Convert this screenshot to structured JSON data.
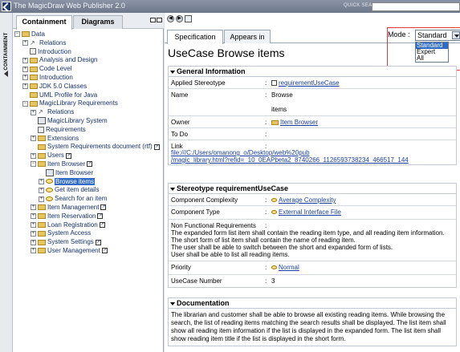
{
  "app": {
    "title": "The MagicDraw Web Publisher 2.0",
    "quick_search_label": "QUICK SEARCH",
    "quick_search_value": ""
  },
  "vertical_tab": {
    "label": "CONTAINMENT"
  },
  "left_tabs": [
    "Containment",
    "Diagrams"
  ],
  "tree": [
    {
      "label": "Data",
      "icon": "folder",
      "exp": "-",
      "depth": 0
    },
    {
      "label": "Relations",
      "icon": "relation",
      "exp": "+",
      "depth": 1
    },
    {
      "label": "Introduction",
      "icon": "doc",
      "exp": "",
      "depth": 1
    },
    {
      "label": "Analysis and Design",
      "icon": "folder",
      "exp": "+",
      "depth": 1
    },
    {
      "label": "Code Level",
      "icon": "folder",
      "exp": "+",
      "depth": 1
    },
    {
      "label": "Introduction",
      "icon": "folder",
      "exp": "+",
      "depth": 1
    },
    {
      "label": "JDK 5.0 Classes",
      "icon": "folder",
      "exp": "+",
      "depth": 1
    },
    {
      "label": "UML Profile for Java",
      "icon": "folder",
      "exp": "",
      "depth": 1
    },
    {
      "label": "MagicLibrary Requirements",
      "icon": "folder",
      "exp": "-",
      "depth": 1
    },
    {
      "label": "Relations",
      "icon": "relation",
      "exp": "+",
      "depth": 2
    },
    {
      "label": "MagicLibrary System",
      "icon": "diagram",
      "exp": "",
      "depth": 2
    },
    {
      "label": "Requirements",
      "icon": "doc",
      "exp": "",
      "depth": 2
    },
    {
      "label": "Extensions",
      "icon": "folder",
      "exp": "+",
      "depth": 2
    },
    {
      "label": "System Requirements document (rtf)",
      "icon": "folder",
      "exp": "",
      "depth": 2,
      "link": true
    },
    {
      "label": "Users",
      "icon": "folder",
      "exp": "+",
      "depth": 2,
      "link": true
    },
    {
      "label": "Item Browser",
      "icon": "folder",
      "exp": "-",
      "depth": 2,
      "link": true
    },
    {
      "label": "Item Browser",
      "icon": "diagram",
      "exp": "",
      "depth": 3
    },
    {
      "label": "Browse items",
      "icon": "usecase",
      "exp": "+",
      "depth": 3,
      "selected": true
    },
    {
      "label": "Get item details",
      "icon": "usecase",
      "exp": "+",
      "depth": 3
    },
    {
      "label": "Search for an item",
      "icon": "usecase",
      "exp": "+",
      "depth": 3
    },
    {
      "label": "Item Management",
      "icon": "folder",
      "exp": "+",
      "depth": 2,
      "link": true
    },
    {
      "label": "Item Reservation",
      "icon": "folder",
      "exp": "+",
      "depth": 2,
      "link": true
    },
    {
      "label": "Loan Registration",
      "icon": "folder",
      "exp": "+",
      "depth": 2,
      "link": true
    },
    {
      "label": "System Access",
      "icon": "folder",
      "exp": "+",
      "depth": 2
    },
    {
      "label": "System Settings",
      "icon": "folder",
      "exp": "+",
      "depth": 2,
      "link": true
    },
    {
      "label": "User Management",
      "icon": "folder",
      "exp": "+",
      "depth": 2,
      "link": true
    }
  ],
  "right_tabs": [
    "Specification",
    "Appears in"
  ],
  "mode": {
    "label": "Mode :",
    "selected": "Standard",
    "options": [
      "Standard",
      "Expert",
      "All"
    ],
    "highlighted": "Standard"
  },
  "page_title": "UseCase Browse items",
  "general": {
    "heading": "General Information",
    "applied_stereotype_label": "Applied Stereotype",
    "applied_stereotype_value": "requirementUseCase",
    "name_label": "Name",
    "name_value_1": "Browse",
    "name_value_2": "items",
    "owner_label": "Owner",
    "owner_value": "Item Browser",
    "todo_label": "To Do",
    "link_label": "Link",
    "link_value_1": "file:///C:/Users/omanong_o/Desktop/web%20pub",
    "link_value_2": "/magic_library.html?refid=_10_0EAPbeta2_8740266_1126593738234_466517_144"
  },
  "stereotype": {
    "heading": "Stereotype requirementUseCase",
    "complexity_label": "Component Complexity",
    "complexity_value": "Average Complexity",
    "type_label": "Component Type",
    "type_value": "External Interface File",
    "nfr_label": "Non Functional Requirements",
    "nfr_lines": [
      "The expanded form list item shall contain the reading item type, and all reading item information.",
      "The short form of list item shall contain the name of reading item.",
      "The user shall be able to switch between the short and expanded form of lists.",
      "User shall be able to list all reading items."
    ],
    "priority_label": "Priority",
    "priority_value": "Normal",
    "ucnum_label": "UseCase Number",
    "ucnum_value": "3"
  },
  "documentation": {
    "heading": "Documentation",
    "text": "The librarian and customer shall be able to browse all existing reading items. While browsing the search, the list of reading items matching the search results shall be displayed. The list item shall show all reading item information if the list is displayed in the expanded form. The list item shall show reading item title if the list is displayed in the short form."
  },
  "colors": {
    "accent": "#316ac5",
    "highlight_box": "#e23a3a",
    "link": "#1a3fa0"
  }
}
